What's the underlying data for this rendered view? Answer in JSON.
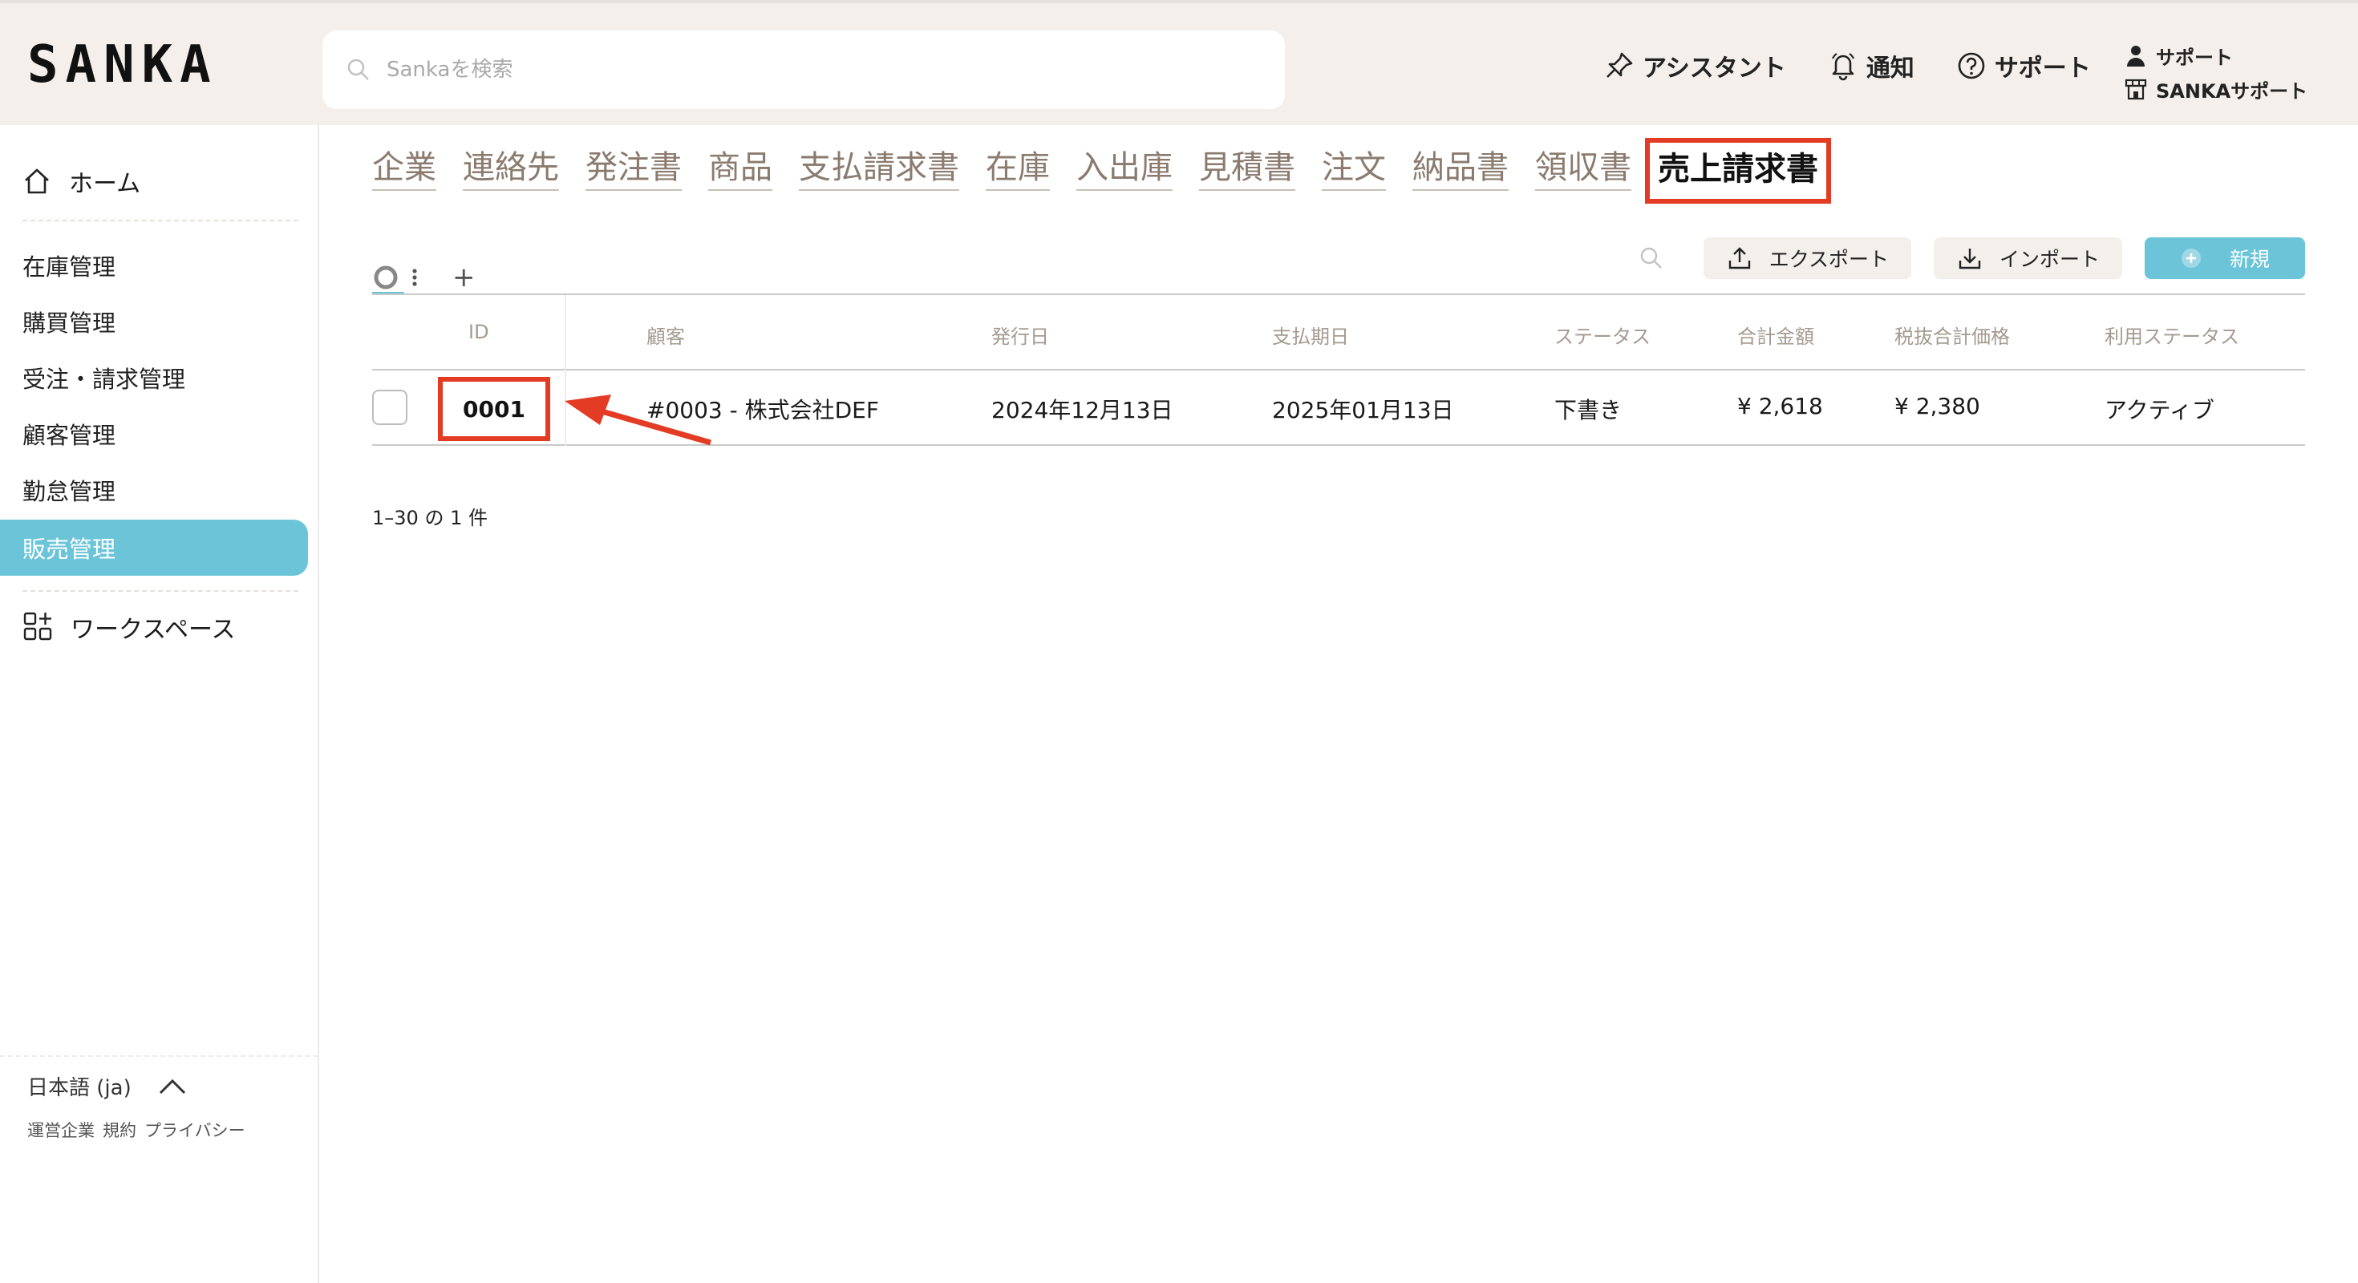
{
  "header": {
    "logo": "SANKA",
    "search_placeholder": "Sankaを検索",
    "nav": [
      {
        "label": "アシスタント",
        "icon": "pin-icon"
      },
      {
        "label": "通知",
        "icon": "bell-icon"
      },
      {
        "label": "サポート",
        "icon": "help-circle-icon"
      }
    ],
    "user": {
      "name": "サポート",
      "workspace": "SANKAサポート"
    }
  },
  "sidebar": {
    "home": "ホーム",
    "items": [
      "在庫管理",
      "購買管理",
      "受注・請求管理",
      "顧客管理",
      "勤怠管理",
      "販売管理"
    ],
    "active_index": 5,
    "workspace": "ワークスペース",
    "language": "日本語 (ja)",
    "footer_links": [
      "運営企業",
      "規約",
      "プライバシー"
    ]
  },
  "tabs": {
    "items": [
      "企業",
      "連絡先",
      "発注書",
      "商品",
      "支払請求書",
      "在庫",
      "入出庫",
      "見積書",
      "注文",
      "納品書",
      "領収書",
      "売上請求書"
    ],
    "active_index": 11
  },
  "toolbar": {
    "add": "+",
    "export": "エクスポート",
    "import": "インポート",
    "new": "新規"
  },
  "table": {
    "headers": [
      "ID",
      "顧客",
      "発行日",
      "支払期日",
      "ステータス",
      "合計金額",
      "税抜合計価格",
      "利用ステータス"
    ],
    "rows": [
      {
        "id": "0001",
        "customer": "#0003 - 株式会社DEF",
        "issue_date": "2024年12月13日",
        "due_date": "2025年01月13日",
        "status": "下書き",
        "total": "¥ 2,618",
        "subtotal": "¥ 2,380",
        "usage_status": "アクティブ"
      }
    ]
  },
  "pagination": "1–30 の 1 件",
  "colors": {
    "accent": "#6cc4d8",
    "highlight": "#e33b24",
    "header_bg": "#f4efea"
  }
}
